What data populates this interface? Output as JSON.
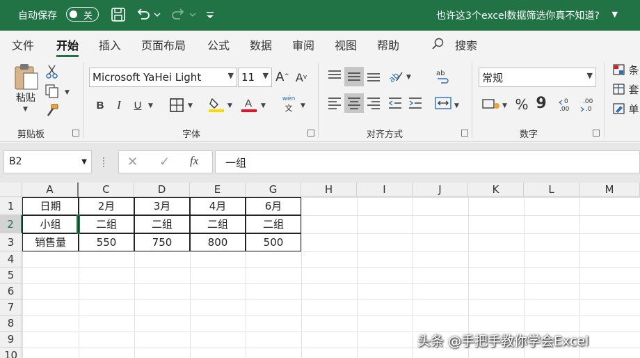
{
  "titlebar": {
    "autosave_label": "自动保存",
    "autosave_state": "关",
    "document_title": "也许这3个excel数据筛选你真不知道?",
    "bg_color": "#217346"
  },
  "tabs": [
    "文件",
    "开始",
    "插入",
    "页面布局",
    "公式",
    "数据",
    "审阅",
    "视图",
    "帮助"
  ],
  "active_tab": "开始",
  "search_label": "搜索",
  "ribbon": {
    "clipboard": {
      "paste_label": "粘贴",
      "group_label": "剪贴板"
    },
    "font": {
      "font_name": "Microsoft YaHei Light",
      "font_size": "11",
      "group_label": "字体",
      "bold": "B",
      "italic": "I",
      "underline": "U",
      "phonetic_top": "wén",
      "phonetic_bottom": "文",
      "fill_color": "#ffd800",
      "font_color": "#e81123"
    },
    "alignment": {
      "group_label": "对齐方式"
    },
    "number": {
      "format": "常规",
      "group_label": "数字",
      "percent": "%",
      "comma": "9"
    },
    "styles": {
      "items": [
        "条",
        "套",
        "单"
      ]
    }
  },
  "formula_bar": {
    "name_box": "B2",
    "fx_label": "fx",
    "content": "一组"
  },
  "grid": {
    "columns": [
      "A",
      "C",
      "D",
      "E",
      "G",
      "H",
      "I",
      "J",
      "K",
      "L",
      "M"
    ],
    "rows": [
      "1",
      "2",
      "3",
      "4",
      "5",
      "6",
      "7",
      "8",
      "9",
      "10"
    ],
    "selected_column": "B",
    "selected_row": "2",
    "data": [
      [
        "日期",
        "2月",
        "3月",
        "4月",
        "6月"
      ],
      [
        "小组",
        "二组",
        "二组",
        "二组",
        "二组"
      ],
      [
        "销售量",
        "550",
        "750",
        "800",
        "500"
      ]
    ]
  },
  "watermark": "头条 @手把手教你学会Excel"
}
